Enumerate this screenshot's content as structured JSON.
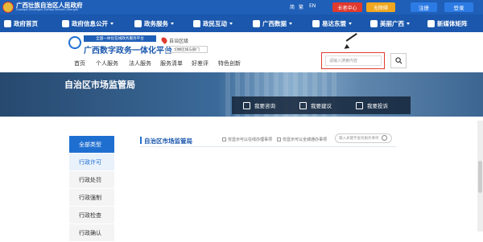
{
  "header": {
    "gov_title": "广西壮族自治区人民政府",
    "gov_pinyin": "Guangxi Zhuangzu Zizhiqu Renmin Zhengfu",
    "lang_simplified": "简",
    "lang_traditional": "繁",
    "lang_english": "EN",
    "elder_mode": "长者中心",
    "accessible": "无障碍",
    "register": "注册",
    "login": "登录"
  },
  "nav": {
    "items": [
      {
        "label": "政府首页",
        "icon": "home-icon"
      },
      {
        "label": "政府信息公开",
        "icon": "document-icon"
      },
      {
        "label": "政务服务",
        "icon": "service-icon"
      },
      {
        "label": "政民互动",
        "icon": "chat-icon"
      },
      {
        "label": "广西数据",
        "icon": "chart-icon"
      },
      {
        "label": "易达东盟",
        "icon": "globe-icon"
      },
      {
        "label": "美丽广西",
        "icon": "landscape-icon"
      },
      {
        "label": "新媒体矩阵",
        "icon": "media-icon"
      }
    ]
  },
  "platform": {
    "banner": "全国一体化在线政务服务平台",
    "name": "广西数字政务一体化平台",
    "region": "自治区级",
    "region_switch": "切换区域与部门"
  },
  "subnav": [
    "首页",
    "个人服务",
    "法人服务",
    "服务清单",
    "好差评",
    "特色创新"
  ],
  "search": {
    "placeholder": "请输入搜索内容"
  },
  "banner": {
    "title": "自治区市场监管局"
  },
  "actions": [
    {
      "label": "我要咨询",
      "icon": "consult-icon"
    },
    {
      "label": "我要建议",
      "icon": "edit-icon"
    },
    {
      "label": "我要投诉",
      "icon": "complaint-icon"
    }
  ],
  "left_menu": [
    "全部类型",
    "行政许可",
    "行政处罚",
    "行政强制",
    "行政检查",
    "行政确认"
  ],
  "section": {
    "title": "自治区市场监管局",
    "check_online": "仅显示可以在线办理事项",
    "check_scope": "仅显示可以全城通办事项",
    "item_search_placeholder": "输入关键字查找服务事项"
  }
}
